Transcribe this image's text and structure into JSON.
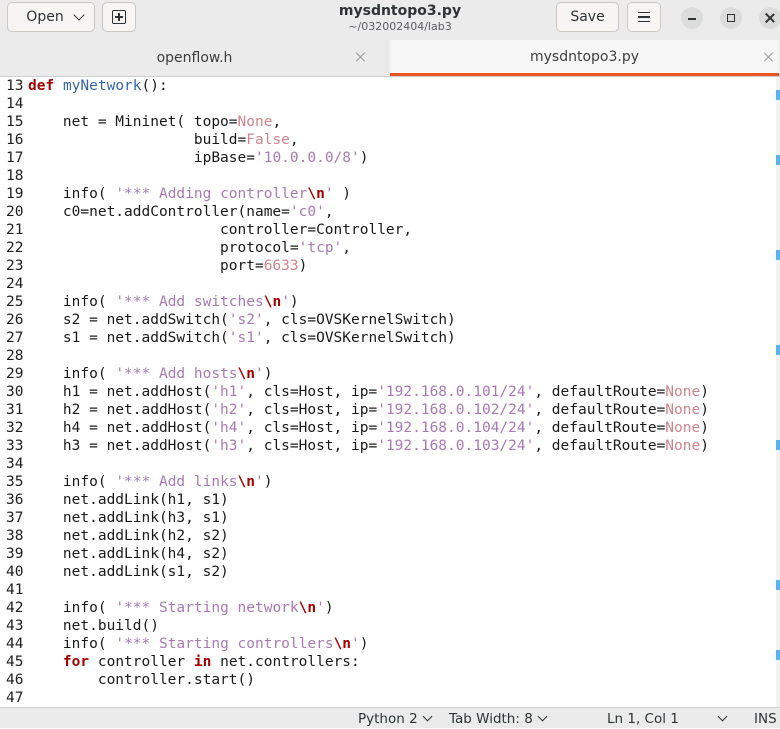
{
  "header": {
    "open_label": "Open",
    "save_label": "Save",
    "title": "mysdntopo3.py",
    "subtitle": "~/032002404/lab3"
  },
  "tabs": [
    {
      "label": "openflow.h",
      "active": false
    },
    {
      "label": "mysdntopo3.py",
      "active": true
    }
  ],
  "accent_color": "#e95420",
  "editor": {
    "lines": [
      {
        "n": "13",
        "t": [
          [
            "kw",
            "def"
          ],
          [
            "c",
            " "
          ],
          [
            "fn",
            "myNetwork"
          ],
          [
            "c",
            "():"
          ]
        ]
      },
      {
        "n": "14",
        "t": []
      },
      {
        "n": "15",
        "t": [
          [
            "c",
            "    net = Mininet( topo="
          ],
          [
            "cst",
            "None"
          ],
          [
            "c",
            ","
          ]
        ]
      },
      {
        "n": "16",
        "t": [
          [
            "c",
            "                   build="
          ],
          [
            "cst",
            "False"
          ],
          [
            "c",
            ","
          ]
        ]
      },
      {
        "n": "17",
        "t": [
          [
            "c",
            "                   ipBase="
          ],
          [
            "str",
            "'10.0.0.0/8'"
          ],
          [
            "c",
            ")"
          ]
        ]
      },
      {
        "n": "18",
        "t": []
      },
      {
        "n": "19",
        "t": [
          [
            "c",
            "    info( "
          ],
          [
            "str",
            "'*** Adding controller"
          ],
          [
            "esc",
            "\\n"
          ],
          [
            "str",
            "'"
          ],
          [
            "c",
            " )"
          ]
        ]
      },
      {
        "n": "20",
        "t": [
          [
            "c",
            "    c0=net.addController(name="
          ],
          [
            "str",
            "'c0'"
          ],
          [
            "c",
            ","
          ]
        ]
      },
      {
        "n": "21",
        "t": [
          [
            "c",
            "                      controller=Controller,"
          ]
        ]
      },
      {
        "n": "22",
        "t": [
          [
            "c",
            "                      protocol="
          ],
          [
            "str",
            "'tcp'"
          ],
          [
            "c",
            ","
          ]
        ]
      },
      {
        "n": "23",
        "t": [
          [
            "c",
            "                      port="
          ],
          [
            "num",
            "6633"
          ],
          [
            "c",
            ")"
          ]
        ]
      },
      {
        "n": "24",
        "t": []
      },
      {
        "n": "25",
        "t": [
          [
            "c",
            "    info( "
          ],
          [
            "str",
            "'*** Add switches"
          ],
          [
            "esc",
            "\\n"
          ],
          [
            "str",
            "'"
          ],
          [
            "c",
            ")"
          ]
        ]
      },
      {
        "n": "26",
        "t": [
          [
            "c",
            "    s2 = net.addSwitch("
          ],
          [
            "str",
            "'s2'"
          ],
          [
            "c",
            ", cls=OVSKernelSwitch)"
          ]
        ]
      },
      {
        "n": "27",
        "t": [
          [
            "c",
            "    s1 = net.addSwitch("
          ],
          [
            "str",
            "'s1'"
          ],
          [
            "c",
            ", cls=OVSKernelSwitch)"
          ]
        ]
      },
      {
        "n": "28",
        "t": []
      },
      {
        "n": "29",
        "t": [
          [
            "c",
            "    info( "
          ],
          [
            "str",
            "'*** Add hosts"
          ],
          [
            "esc",
            "\\n"
          ],
          [
            "str",
            "'"
          ],
          [
            "c",
            ")"
          ]
        ]
      },
      {
        "n": "30",
        "t": [
          [
            "c",
            "    h1 = net.addHost("
          ],
          [
            "str",
            "'h1'"
          ],
          [
            "c",
            ", cls=Host, ip="
          ],
          [
            "str",
            "'192.168.0.101/24'"
          ],
          [
            "c",
            ", defaultRoute="
          ],
          [
            "cst",
            "None"
          ],
          [
            "c",
            ")"
          ]
        ]
      },
      {
        "n": "31",
        "t": [
          [
            "c",
            "    h2 = net.addHost("
          ],
          [
            "str",
            "'h2'"
          ],
          [
            "c",
            ", cls=Host, ip="
          ],
          [
            "str",
            "'192.168.0.102/24'"
          ],
          [
            "c",
            ", defaultRoute="
          ],
          [
            "cst",
            "None"
          ],
          [
            "c",
            ")"
          ]
        ]
      },
      {
        "n": "32",
        "t": [
          [
            "c",
            "    h4 = net.addHost("
          ],
          [
            "str",
            "'h4'"
          ],
          [
            "c",
            ", cls=Host, ip="
          ],
          [
            "str",
            "'192.168.0.104/24'"
          ],
          [
            "c",
            ", defaultRoute="
          ],
          [
            "cst",
            "None"
          ],
          [
            "c",
            ")"
          ]
        ]
      },
      {
        "n": "33",
        "t": [
          [
            "c",
            "    h3 = net.addHost("
          ],
          [
            "str",
            "'h3'"
          ],
          [
            "c",
            ", cls=Host, ip="
          ],
          [
            "str",
            "'192.168.0.103/24'"
          ],
          [
            "c",
            ", defaultRoute="
          ],
          [
            "cst",
            "None"
          ],
          [
            "c",
            ")"
          ]
        ]
      },
      {
        "n": "34",
        "t": []
      },
      {
        "n": "35",
        "t": [
          [
            "c",
            "    info( "
          ],
          [
            "str",
            "'*** Add links"
          ],
          [
            "esc",
            "\\n"
          ],
          [
            "str",
            "'"
          ],
          [
            "c",
            ")"
          ]
        ]
      },
      {
        "n": "36",
        "t": [
          [
            "c",
            "    net.addLink(h1, s1)"
          ]
        ]
      },
      {
        "n": "37",
        "t": [
          [
            "c",
            "    net.addLink(h3, s1)"
          ]
        ]
      },
      {
        "n": "38",
        "t": [
          [
            "c",
            "    net.addLink(h2, s2)"
          ]
        ]
      },
      {
        "n": "39",
        "t": [
          [
            "c",
            "    net.addLink(h4, s2)"
          ]
        ]
      },
      {
        "n": "40",
        "t": [
          [
            "c",
            "    net.addLink(s1, s2)"
          ]
        ]
      },
      {
        "n": "41",
        "t": []
      },
      {
        "n": "42",
        "t": [
          [
            "c",
            "    info( "
          ],
          [
            "str",
            "'*** Starting network"
          ],
          [
            "esc",
            "\\n"
          ],
          [
            "str",
            "'"
          ],
          [
            "c",
            ")"
          ]
        ]
      },
      {
        "n": "43",
        "t": [
          [
            "c",
            "    net.build()"
          ]
        ]
      },
      {
        "n": "44",
        "t": [
          [
            "c",
            "    info( "
          ],
          [
            "str",
            "'*** Starting controllers"
          ],
          [
            "esc",
            "\\n"
          ],
          [
            "str",
            "'"
          ],
          [
            "c",
            ")"
          ]
        ]
      },
      {
        "n": "45",
        "t": [
          [
            "c",
            "    "
          ],
          [
            "kw",
            "for"
          ],
          [
            "c",
            " controller "
          ],
          [
            "kw",
            "in"
          ],
          [
            "c",
            " net.controllers:"
          ]
        ]
      },
      {
        "n": "46",
        "t": [
          [
            "c",
            "        controller.start()"
          ]
        ]
      },
      {
        "n": "47",
        "t": []
      }
    ]
  },
  "statusbar": {
    "language": "Python 2",
    "tab_width": "Tab Width: 8",
    "position": "Ln 1, Col 1",
    "mode": "INS"
  }
}
